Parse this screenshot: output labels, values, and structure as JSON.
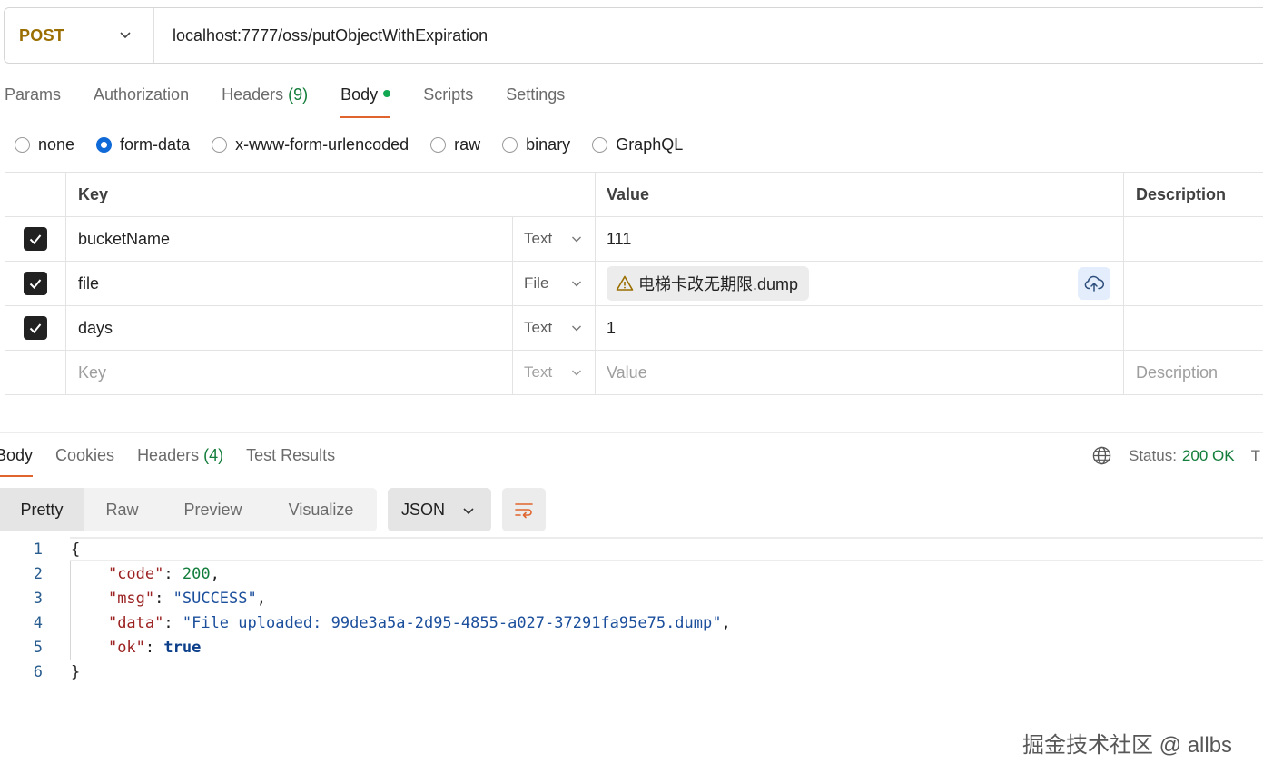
{
  "request": {
    "method": "POST",
    "url": "localhost:7777/oss/putObjectWithExpiration",
    "tabs": {
      "params": "Params",
      "authorization": "Authorization",
      "headers": "Headers",
      "headers_count": "(9)",
      "body": "Body",
      "scripts": "Scripts",
      "settings": "Settings"
    },
    "body_types": {
      "none": "none",
      "form_data": "form-data",
      "urlencoded": "x-www-form-urlencoded",
      "raw": "raw",
      "binary": "binary",
      "graphql": "GraphQL",
      "selected": "form-data"
    },
    "table": {
      "headers": {
        "key": "Key",
        "value": "Value",
        "description": "Description"
      },
      "rows": [
        {
          "checked": true,
          "key": "bucketName",
          "type": "Text",
          "value": "111"
        },
        {
          "checked": true,
          "key": "file",
          "type": "File",
          "value": "电梯卡改无期限.dump"
        },
        {
          "checked": true,
          "key": "days",
          "type": "Text",
          "value": "1"
        }
      ],
      "empty_row": {
        "key": "Key",
        "type": "Text",
        "value": "Value",
        "description": "Description"
      }
    }
  },
  "response": {
    "tabs": {
      "body": "Body",
      "cookies": "Cookies",
      "headers": "Headers",
      "headers_count": "(4)",
      "test_results": "Test Results"
    },
    "status_label": "Status:",
    "status_value": "200 OK",
    "truncated": "T",
    "views": {
      "pretty": "Pretty",
      "raw": "Raw",
      "preview": "Preview",
      "visualize": "Visualize"
    },
    "format": "JSON",
    "code": {
      "line_numbers": [
        "1",
        "2",
        "3",
        "4",
        "5",
        "6"
      ],
      "open_brace": "{",
      "close_brace": "}",
      "code_key": "\"code\"",
      "code_value": "200",
      "msg_key": "\"msg\"",
      "msg_value": "\"SUCCESS\"",
      "data_key": "\"data\"",
      "data_value": "\"File uploaded: 99de3a5a-2d95-4855-a027-37291fa95e75.dump\"",
      "ok_key": "\"ok\"",
      "ok_value": "true",
      "colon": ": ",
      "comma": ","
    }
  },
  "watermark": "掘金技术社区 @ allbs",
  "colors": {
    "method": "#9a6e00",
    "accent": "#e0642d",
    "success": "#137d3b",
    "radio_selected": "#0f6ad8"
  }
}
